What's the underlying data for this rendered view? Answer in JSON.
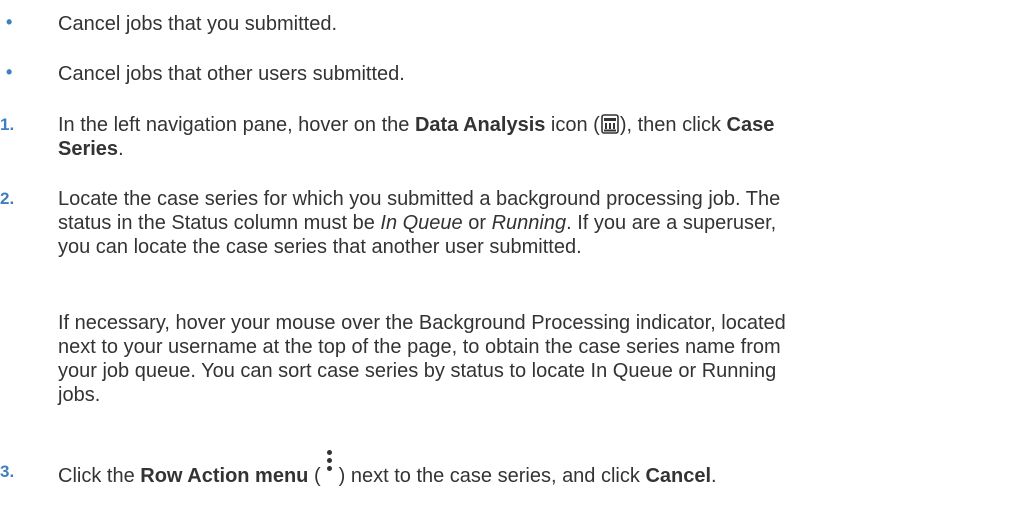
{
  "bullets": [
    "Cancel jobs that you submitted.",
    "Cancel jobs that other users submitted."
  ],
  "steps": [
    {
      "number": "1.",
      "t1": "In the left navigation pane, hover on the ",
      "b1": "Data Analysis",
      "t2": " icon (",
      "icon": "data-analysis-icon",
      "t3": "), then click ",
      "b2": "Case",
      "b3": "Series",
      "t4": "."
    },
    {
      "number": "2.",
      "line1": "Locate the case series for which you submitted a background processing job. The",
      "l2_pre": "status in the Status column must be ",
      "l2_i1": "In Queue",
      "l2_mid": " or ",
      "l2_i2": "Running",
      "l2_post": ". If you are a superuser,",
      "line3": "you can locate the case series that another user submitted.",
      "para2": [
        "If necessary, hover your mouse over the Background Processing indicator, located",
        "next to your username at the top of the page, to obtain the case series name from",
        "your job queue. You can sort case series by status to locate In Queue or Running",
        "jobs."
      ]
    },
    {
      "number": "3.",
      "t1": "Click the ",
      "b1": "Row Action menu",
      "t2": " (",
      "icon": "kebab-menu-icon",
      "t3": ") next to the case series, and click ",
      "b2": "Cancel",
      "t4": "."
    }
  ],
  "colors": {
    "marker": "#3f7fbf",
    "text": "#333333"
  }
}
